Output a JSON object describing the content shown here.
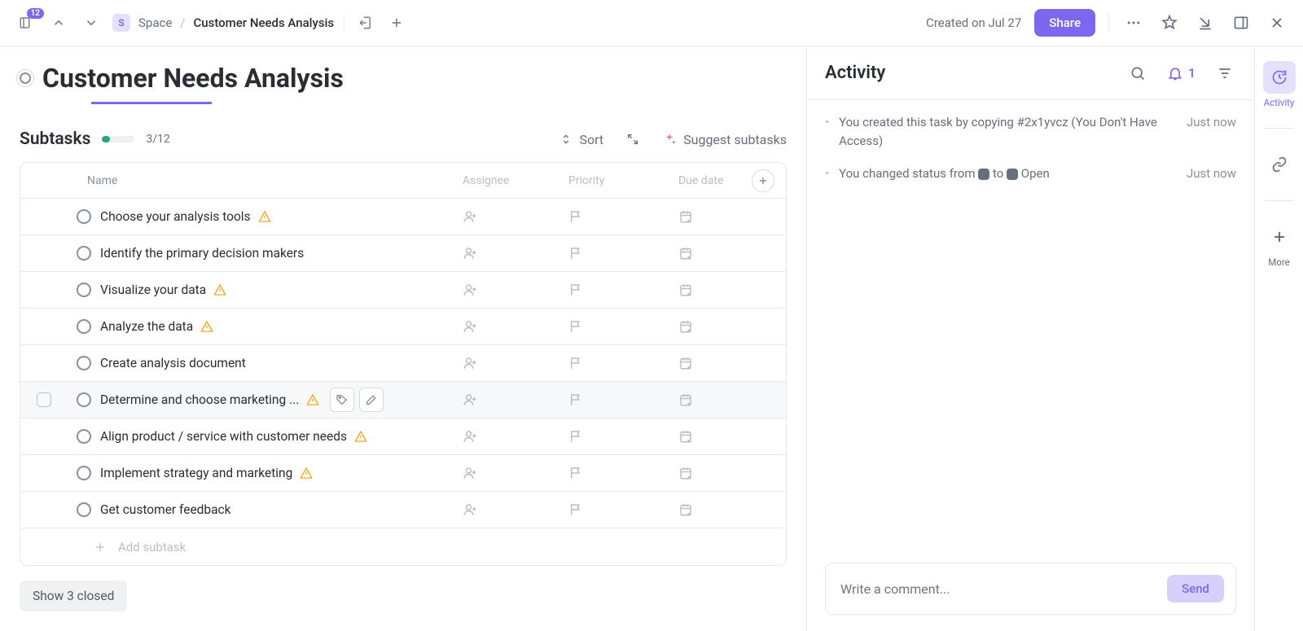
{
  "topbar": {
    "nav_badge": "12",
    "space_icon_letter": "S",
    "space_label": "Space",
    "current_task": "Customer Needs Analysis",
    "created_label": "Created on Jul 27",
    "share_label": "Share"
  },
  "task": {
    "title": "Customer Needs Analysis"
  },
  "subtasks": {
    "heading": "Subtasks",
    "progress_text": "3/12",
    "progress_pct": 25,
    "sort_label": "Sort",
    "suggest_label": "Suggest subtasks",
    "columns": {
      "name": "Name",
      "assignee": "Assignee",
      "priority": "Priority",
      "due": "Due date"
    },
    "rows": [
      {
        "name": "Choose your analysis tools",
        "warn": true,
        "hovered": false
      },
      {
        "name": "Identify the primary decision makers",
        "warn": false,
        "hovered": false
      },
      {
        "name": "Visualize your data",
        "warn": true,
        "hovered": false
      },
      {
        "name": "Analyze the data",
        "warn": true,
        "hovered": false
      },
      {
        "name": "Create analysis document",
        "warn": false,
        "hovered": false
      },
      {
        "name": "Determine and choose marketing ...",
        "warn": true,
        "hovered": true
      },
      {
        "name": "Align product / service with customer needs",
        "warn": true,
        "hovered": false
      },
      {
        "name": "Implement strategy and marketing",
        "warn": true,
        "hovered": false
      },
      {
        "name": "Get customer feedback",
        "warn": false,
        "hovered": false
      }
    ],
    "add_label": "Add subtask",
    "show_closed_label": "Show 3 closed"
  },
  "activity": {
    "heading": "Activity",
    "notif_count": "1",
    "items": [
      {
        "text_before": "You created this task by copying #2x1yvcz (You Don't Have Access)",
        "status_change": false,
        "time": "Just now"
      },
      {
        "text_before": "You changed status from ",
        "status_change": true,
        "status_to_label": "Open",
        "time": "Just now"
      }
    ],
    "comment_placeholder": "Write a comment...",
    "send_label": "Send"
  },
  "rail": {
    "activity_label": "Activity",
    "more_label": "More"
  }
}
